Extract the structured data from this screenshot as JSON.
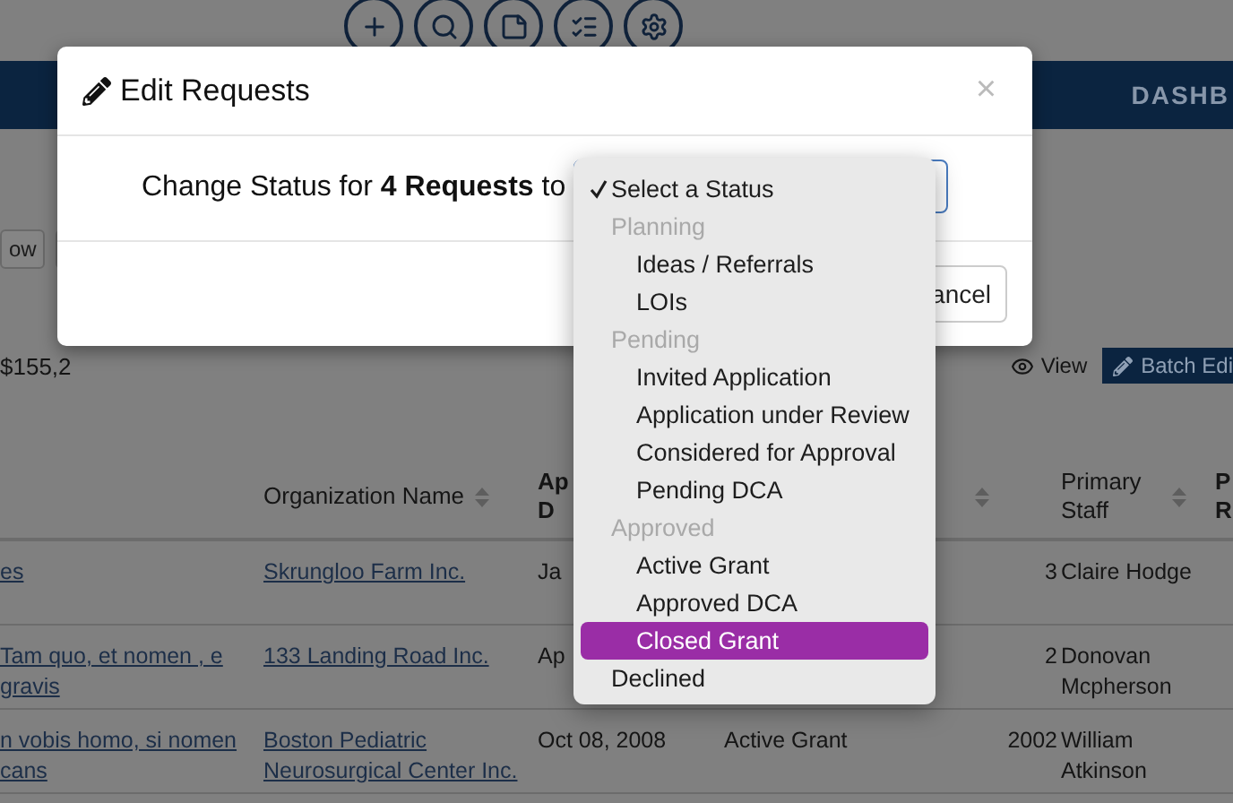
{
  "nav": {
    "label": "DASHB"
  },
  "toolbar": {
    "button": "ow"
  },
  "summary": {
    "total": "$155,2",
    "view_button": "View",
    "batch_button": "Batch Edi"
  },
  "table": {
    "columns": [
      {},
      {
        "label": "Organization Name",
        "sortable": true
      },
      {
        "label": "Ap D"
      },
      {},
      {
        "sortable": true
      },
      {
        "label": "Primary Staff",
        "sortable": true
      },
      {
        "label": "P R"
      }
    ],
    "rows": [
      {
        "column_1": "es",
        "organization_name": "Skrungloo Farm Inc.",
        "column_3": "Ja",
        "column_5": "3",
        "primary_staff": "Claire Hodge"
      },
      {
        "column_1": "Tam quo, et nomen , e gravis",
        "organization_name": "133 Landing Road Inc.",
        "column_3": "Ap",
        "column_5": "2",
        "primary_staff": "Donovan Mcpherson"
      },
      {
        "column_1": "n vobis homo, si nomen cans",
        "organization_name": "Boston Pediatric Neurosurgical Center Inc.",
        "column_3": "Oct 08, 2008",
        "column_4": "Active Grant",
        "column_5": "2002",
        "primary_staff": "William Atkinson"
      }
    ]
  },
  "modal": {
    "title": "Edit Requests",
    "close": "×",
    "prompt": "Change Status for **4 Requests** to",
    "cancel_button": "ancel"
  },
  "status_menu": {
    "options": [
      {
        "kind": "option",
        "label": "Select a Status",
        "checked": true,
        "selected": false
      },
      {
        "kind": "group",
        "label": "Planning",
        "children": [
          {
            "label": "Ideas / Referrals",
            "checked": false,
            "selected": false
          },
          {
            "label": "LOIs",
            "checked": false,
            "selected": false
          }
        ]
      },
      {
        "kind": "group",
        "label": "Pending",
        "children": [
          {
            "label": "Invited Application",
            "checked": false,
            "selected": false
          },
          {
            "label": "Application under Review",
            "checked": false,
            "selected": false
          },
          {
            "label": "Considered for Approval",
            "checked": false,
            "selected": false
          },
          {
            "label": "Pending DCA",
            "checked": false,
            "selected": false
          }
        ]
      },
      {
        "kind": "group",
        "label": "Approved",
        "children": [
          {
            "label": "Active Grant",
            "checked": false,
            "selected": false
          },
          {
            "label": "Approved DCA",
            "checked": false,
            "selected": false
          },
          {
            "label": "Closed Grant",
            "checked": false,
            "selected": true
          }
        ]
      },
      {
        "kind": "option",
        "label": "Declined",
        "checked": false,
        "selected": false
      }
    ]
  }
}
